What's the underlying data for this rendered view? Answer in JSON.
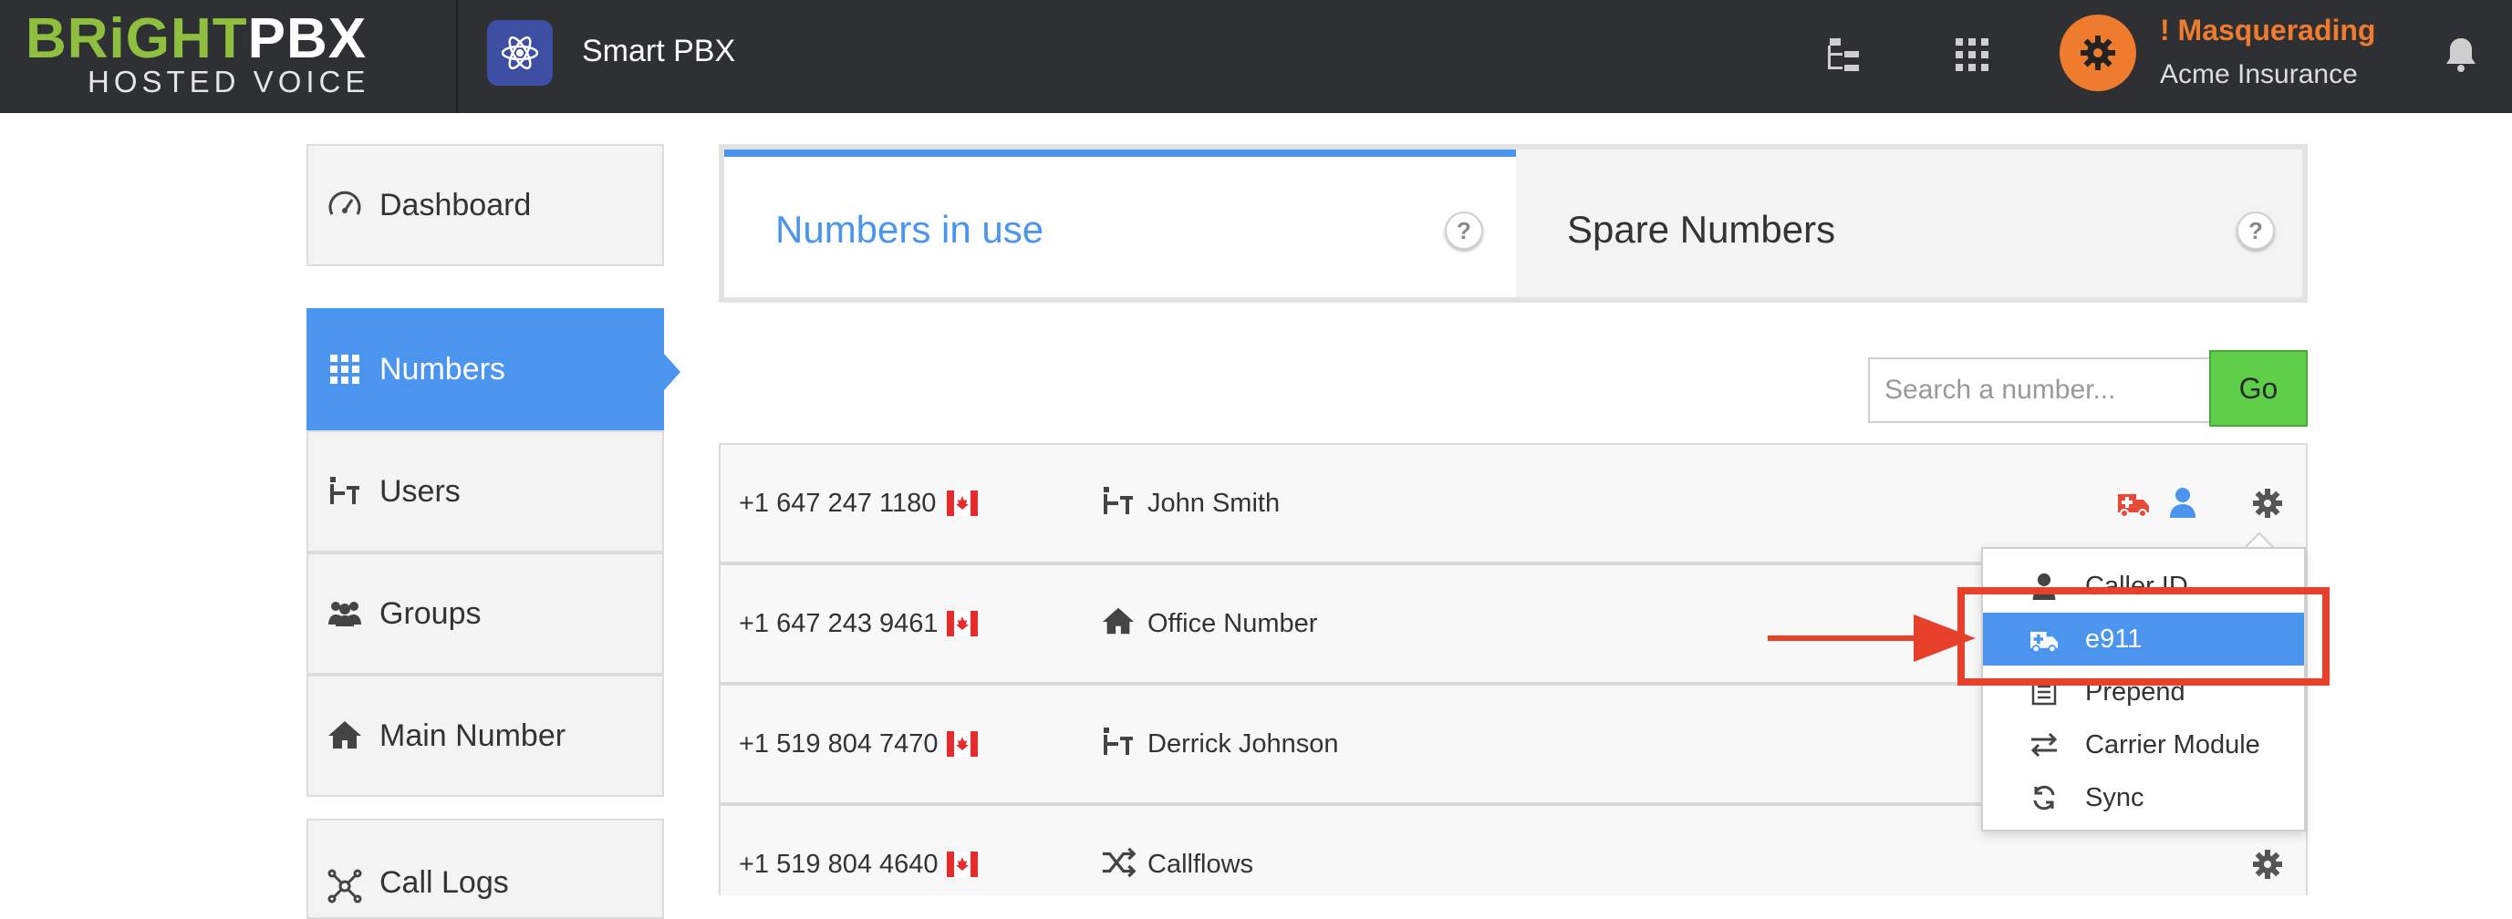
{
  "header": {
    "logo_part1": "BRiGHT",
    "logo_part2": "PBX",
    "logo_sub": "HOSTED VOICE",
    "app_name": "Smart PBX",
    "masquerade_title": "! Masquerading",
    "masquerade_account": "Acme Insurance",
    "icons": [
      "atom-icon",
      "org-chart-icon",
      "apps-grid-icon",
      "gear-icon",
      "bell-icon"
    ]
  },
  "sidebar": {
    "items": [
      {
        "label": "Dashboard",
        "icon": "speedometer-icon"
      },
      {
        "label": "Numbers",
        "icon": "grid-icon"
      },
      {
        "label": "Users",
        "icon": "user-desk-icon"
      },
      {
        "label": "Groups",
        "icon": "group-icon"
      },
      {
        "label": "Main Number",
        "icon": "home-icon"
      },
      {
        "label": "Call Logs",
        "icon": "network-icon"
      }
    ]
  },
  "tabs": {
    "active": "Numbers in use",
    "spare": "Spare Numbers",
    "help": "?"
  },
  "search": {
    "placeholder": "Search a number...",
    "go_label": "Go"
  },
  "rows": [
    {
      "number": "+1 647 247 1180",
      "name": "John Smith",
      "icon": "user-desk-icon"
    },
    {
      "number": "+1 647 243 9461",
      "name": "Office Number",
      "icon": "home-icon"
    },
    {
      "number": "+1 519 804 7470",
      "name": "Derrick Johnson",
      "icon": "user-desk-icon"
    },
    {
      "number": "+1 519 804 4640",
      "name": "Callflows",
      "icon": "shuffle-icon"
    }
  ],
  "dropdown": {
    "items": [
      {
        "label": "Caller ID",
        "icon": "user-icon"
      },
      {
        "label": "e911",
        "icon": "ambulance-icon",
        "selected": true
      },
      {
        "label": "Prepend",
        "icon": "list-icon"
      },
      {
        "label": "Carrier Module",
        "icon": "swap-icon"
      },
      {
        "label": "Sync",
        "icon": "refresh-icon"
      }
    ]
  },
  "colors": {
    "topbar": "#2f3033",
    "accent_blue": "#4b95ef",
    "brand_green": "#8fbf3f",
    "masquerade_orange": "#ef7b2e",
    "go_green": "#5fcf4a",
    "annotation_red": "#e8412b",
    "e911_red": "#e84a3a"
  }
}
